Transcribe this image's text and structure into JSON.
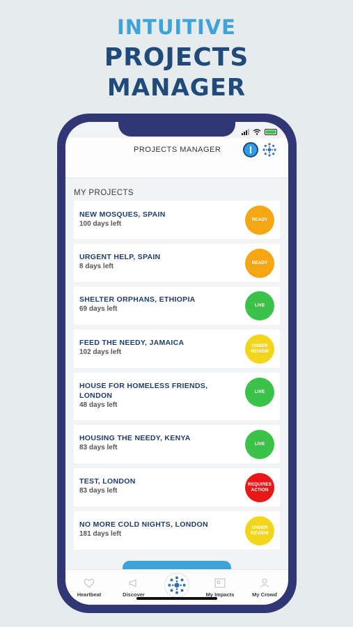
{
  "hero": {
    "line1": "INTUITIVE",
    "line2": "PROJECTS",
    "line3": "MANAGER"
  },
  "appbar": {
    "title": "PROJECTS MANAGER"
  },
  "section_title": "MY PROJECTS",
  "projects": [
    {
      "title": "NEW MOSQUES, SPAIN",
      "days": "100 days left",
      "status": "READY",
      "color": "#f5a713"
    },
    {
      "title": "URGENT HELP, SPAIN",
      "days": "8 days left",
      "status": "READY",
      "color": "#f5a713"
    },
    {
      "title": "SHELTER ORPHANS, ETHIOPIA",
      "days": "69 days left",
      "status": "LIVE",
      "color": "#3cc24a"
    },
    {
      "title": "FEED THE NEEDY, JAMAICA",
      "days": "102 days left",
      "status": "UNDER REVIEW",
      "color": "#f3d61c"
    },
    {
      "title": "HOUSE FOR HOMELESS FRIENDS, LONDON",
      "days": "48 days left",
      "status": "LIVE",
      "color": "#3cc24a"
    },
    {
      "title": "HOUSING THE NEEDY, KENYA",
      "days": "83 days left",
      "status": "LIVE",
      "color": "#3cc24a"
    },
    {
      "title": "TEST, LONDON",
      "days": "83 days left",
      "status": "REQUIRES ACTION",
      "color": "#e91717"
    },
    {
      "title": "NO MORE COLD NIGHTS, LONDON",
      "days": "181 days left",
      "status": "UNDER REVIEW",
      "color": "#f3d61c"
    }
  ],
  "tabs": [
    {
      "label": "Heartbeat",
      "icon": "heart-icon"
    },
    {
      "label": "Discover",
      "icon": "megaphone-icon"
    },
    {
      "label": "",
      "icon": "organisation-logo-icon"
    },
    {
      "label": "My Impacts",
      "icon": "image-icon"
    },
    {
      "label": "My Crowd",
      "icon": "people-icon"
    }
  ]
}
